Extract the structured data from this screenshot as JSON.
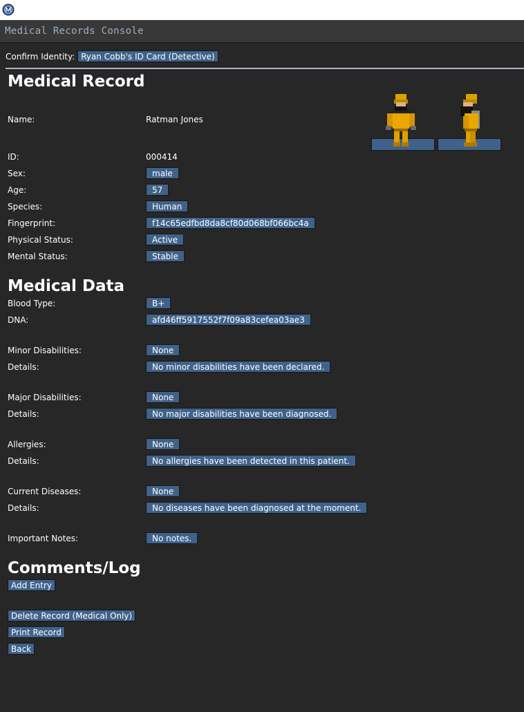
{
  "window": {
    "title": "Medical Records Console",
    "icon": "nanotrasen-logo-icon"
  },
  "identity": {
    "label": "Confirm Identity:",
    "card": "Ryan Cobb's ID Card (Detective)"
  },
  "record": {
    "heading": "Medical Record",
    "fields": {
      "name_label": "Name:",
      "name": "Ratman Jones",
      "id_label": "ID:",
      "id": "000414",
      "sex_label": "Sex:",
      "sex": "male",
      "age_label": "Age:",
      "age": "57",
      "species_label": "Species:",
      "species": "Human",
      "fingerprint_label": "Fingerprint:",
      "fingerprint": "f14c65edfbd8da8cf80d068bf066bc4a",
      "physical_label": "Physical Status:",
      "physical": "Active",
      "mental_label": "Mental Status:",
      "mental": "Stable"
    }
  },
  "medical": {
    "heading": "Medical Data",
    "blood_label": "Blood Type:",
    "blood": "B+",
    "dna_label": "DNA:",
    "dna": "afd46ff5917552f7f09a83cefea03ae3",
    "minor_label": "Minor Disabilities:",
    "minor": "None",
    "minor_details_label": "Details:",
    "minor_details": "No minor disabilities have been declared.",
    "major_label": "Major Disabilities:",
    "major": "None",
    "major_details_label": "Details:",
    "major_details": "No major disabilities have been diagnosed.",
    "allergies_label": "Allergies:",
    "allergies": "None",
    "allergies_details_label": "Details:",
    "allergies_details": "No allergies have been detected in this patient.",
    "diseases_label": "Current Diseases:",
    "diseases": "None",
    "diseases_details_label": "Details:",
    "diseases_details": "No diseases have been diagnosed at the moment.",
    "notes_label": "Important Notes:",
    "notes": "No notes."
  },
  "comments": {
    "heading": "Comments/Log",
    "add_entry": "Add Entry"
  },
  "actions": {
    "delete": "Delete Record (Medical Only)",
    "print": "Print Record",
    "back": "Back"
  },
  "colors": {
    "background": "#272727",
    "button": "#40628a",
    "header": "#383838"
  }
}
